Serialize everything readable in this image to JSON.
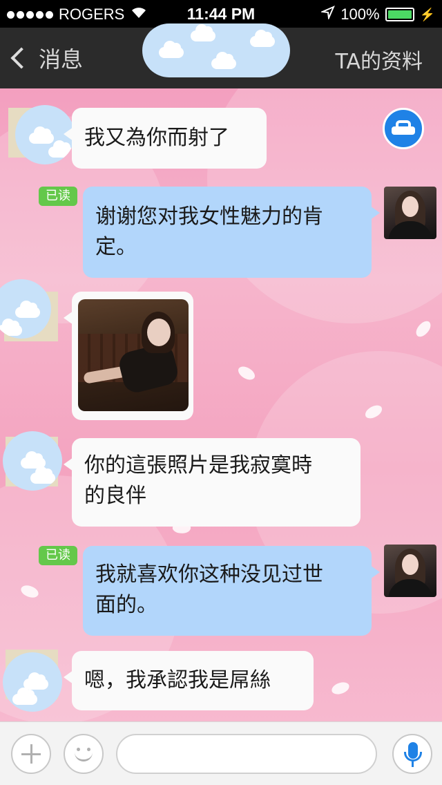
{
  "status_bar": {
    "carrier": "ROGERS",
    "time": "11:44 PM",
    "battery": "100%",
    "battery_level": 1.0
  },
  "nav": {
    "back_label": "消息",
    "profile_label": "TA的资料"
  },
  "messages": [
    {
      "side": "incoming",
      "text": "我又為你而射了"
    },
    {
      "side": "outgoing",
      "read": "已读",
      "text": "谢谢您对我女性魅力的肯定。"
    },
    {
      "side": "incoming",
      "type": "photo"
    },
    {
      "side": "incoming",
      "text": "你的這張照片是我寂寞時的良伴"
    },
    {
      "side": "outgoing",
      "read": "已读",
      "text": "我就喜欢你这种没见过世面的。"
    },
    {
      "side": "incoming",
      "text": "嗯，我承認我是屌絲"
    }
  ],
  "lines": {
    "m1": [
      "我又為你而射了"
    ],
    "m2": [
      "谢谢您对我女性魅力的肯",
      "定。"
    ],
    "m4": [
      "你的這張照片是我寂寞時",
      "的良伴"
    ],
    "m5": [
      "我就喜欢你这种没见过世",
      "面的。"
    ],
    "m6": [
      "嗯，我承認我是屌絲"
    ]
  },
  "icons": {
    "car": "car-icon",
    "plus": "plus-icon",
    "emoji": "smiley-icon",
    "voice": "microphone-icon"
  },
  "colors": {
    "incoming_bubble": "#fafafa",
    "outgoing_bubble": "#b2d6fb",
    "read_badge": "#64c84a",
    "accent_blue": "#1f82e6",
    "nav_bg": "#2b2b2b"
  }
}
